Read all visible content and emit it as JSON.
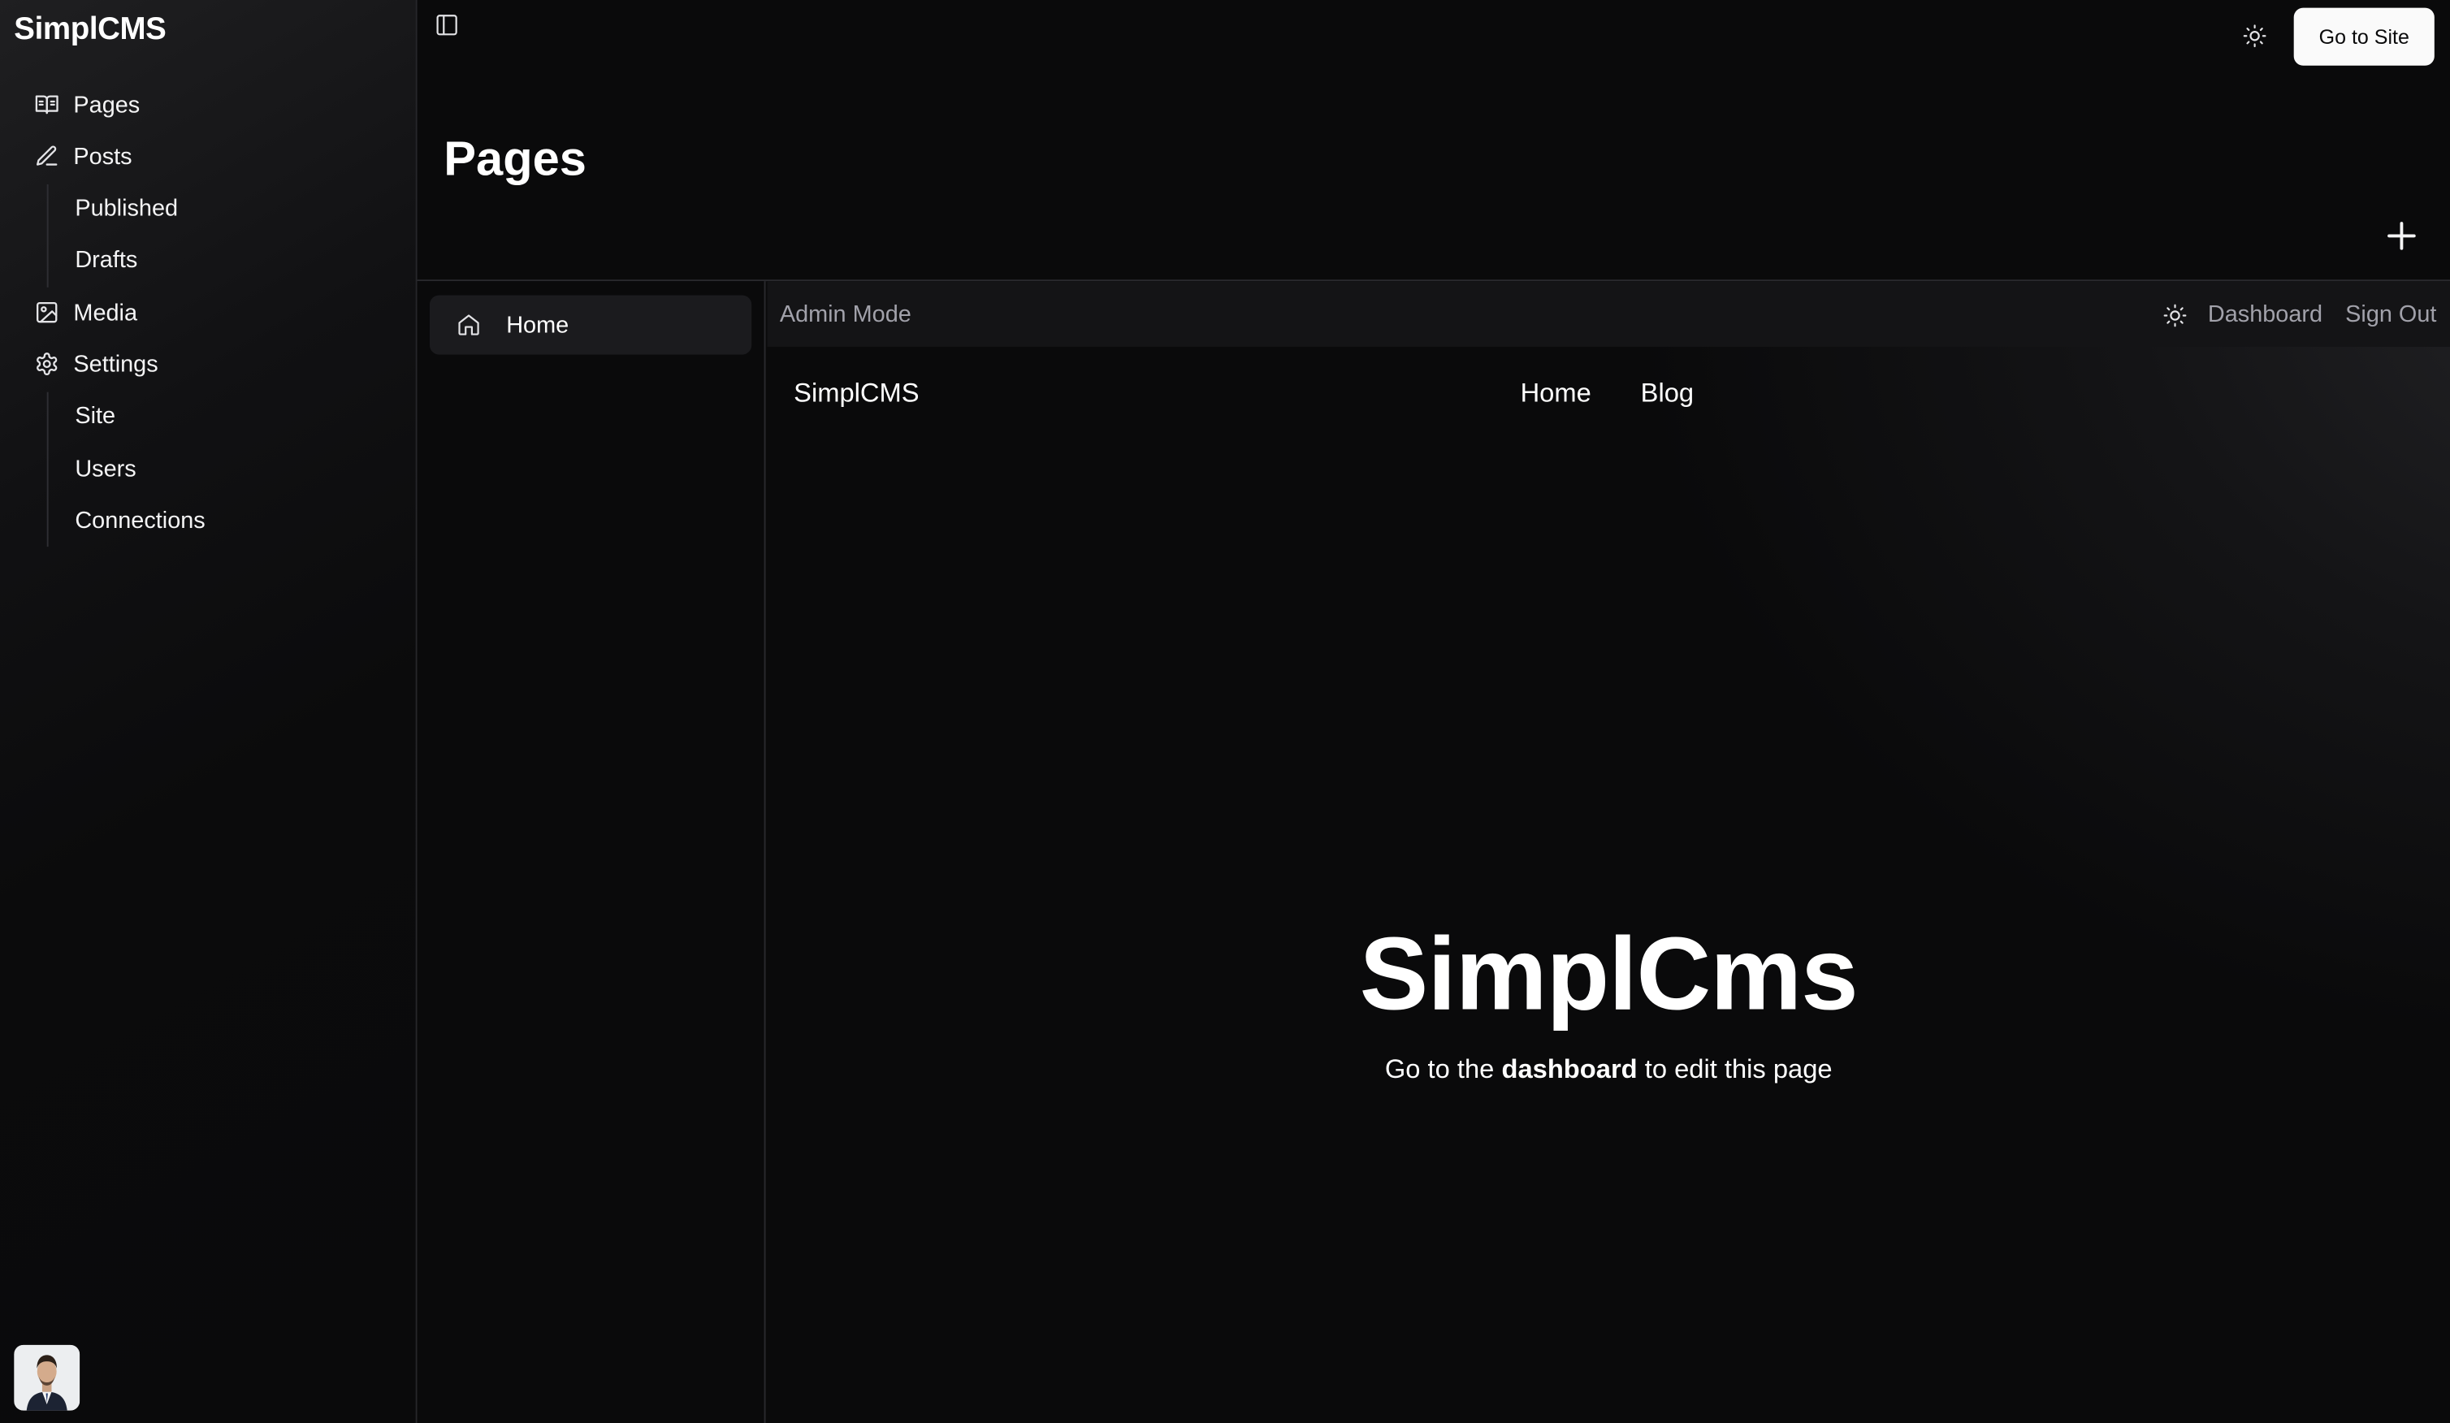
{
  "sidebar": {
    "brand": "SimplCMS",
    "items": [
      {
        "label": "Pages",
        "icon": "book-open-icon"
      },
      {
        "label": "Posts",
        "icon": "pencil-icon"
      },
      {
        "label": "Published"
      },
      {
        "label": "Drafts"
      },
      {
        "label": "Media",
        "icon": "image-icon"
      },
      {
        "label": "Settings",
        "icon": "gear-icon"
      },
      {
        "label": "Site"
      },
      {
        "label": "Users"
      },
      {
        "label": "Connections"
      }
    ]
  },
  "header": {
    "goto_site": "Go to Site",
    "page_title": "Pages"
  },
  "pages_list": [
    {
      "label": "Home",
      "icon": "home-icon"
    }
  ],
  "preview": {
    "admin_mode": "Admin Mode",
    "dashboard": "Dashboard",
    "sign_out": "Sign Out",
    "site_logo": "SimplCMS",
    "nav": [
      "Home",
      "Blog"
    ],
    "hero_title": "SimplCms",
    "hero_sub_before": "Go to the ",
    "hero_sub_bold": "dashboard",
    "hero_sub_after": " to edit this page"
  }
}
